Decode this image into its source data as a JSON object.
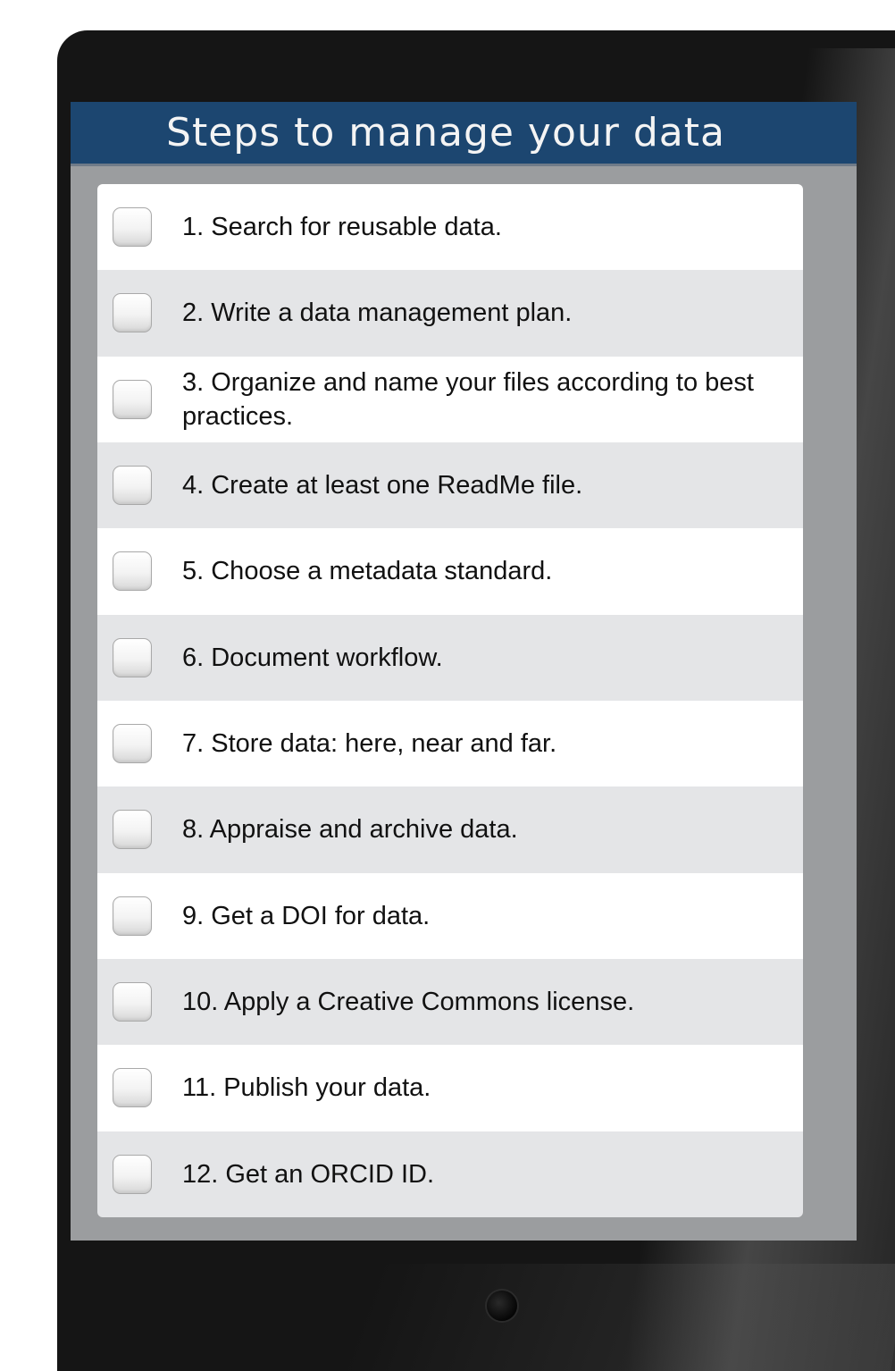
{
  "header": {
    "title": "Steps to manage your data"
  },
  "checklist": {
    "items": [
      {
        "label": "1. Search for reusable data.",
        "checked": false
      },
      {
        "label": "2. Write a data management plan.",
        "checked": false
      },
      {
        "label": "3. Organize and name your files according to best practices.",
        "checked": false
      },
      {
        "label": "4. Create at least one ReadMe file.",
        "checked": false
      },
      {
        "label": "5. Choose a metadata standard.",
        "checked": false
      },
      {
        "label": "6. Document workflow.",
        "checked": false
      },
      {
        "label": "7. Store data: here, near and far.",
        "checked": false
      },
      {
        "label": "8. Appraise and archive data.",
        "checked": false
      },
      {
        "label": "9. Get a DOI for data.",
        "checked": false
      },
      {
        "label": "10. Apply a Creative Commons license.",
        "checked": false
      },
      {
        "label": "11. Publish your data.",
        "checked": false
      },
      {
        "label": "12. Get an ORCID ID.",
        "checked": false
      }
    ]
  },
  "colors": {
    "header_bg": "#1c4670",
    "screen_frame": "#9b9d9f",
    "row_alt": "#e4e5e7",
    "bezel": "#151515"
  }
}
